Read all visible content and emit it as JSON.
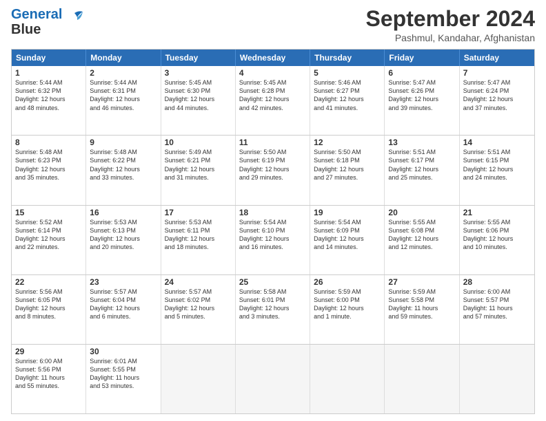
{
  "logo": {
    "line1": "General",
    "line2": "Blue"
  },
  "title": "September 2024",
  "subtitle": "Pashmul, Kandahar, Afghanistan",
  "header_days": [
    "Sunday",
    "Monday",
    "Tuesday",
    "Wednesday",
    "Thursday",
    "Friday",
    "Saturday"
  ],
  "weeks": [
    [
      {
        "day": "1",
        "info": "Sunrise: 5:44 AM\nSunset: 6:32 PM\nDaylight: 12 hours\nand 48 minutes."
      },
      {
        "day": "2",
        "info": "Sunrise: 5:44 AM\nSunset: 6:31 PM\nDaylight: 12 hours\nand 46 minutes."
      },
      {
        "day": "3",
        "info": "Sunrise: 5:45 AM\nSunset: 6:30 PM\nDaylight: 12 hours\nand 44 minutes."
      },
      {
        "day": "4",
        "info": "Sunrise: 5:45 AM\nSunset: 6:28 PM\nDaylight: 12 hours\nand 42 minutes."
      },
      {
        "day": "5",
        "info": "Sunrise: 5:46 AM\nSunset: 6:27 PM\nDaylight: 12 hours\nand 41 minutes."
      },
      {
        "day": "6",
        "info": "Sunrise: 5:47 AM\nSunset: 6:26 PM\nDaylight: 12 hours\nand 39 minutes."
      },
      {
        "day": "7",
        "info": "Sunrise: 5:47 AM\nSunset: 6:24 PM\nDaylight: 12 hours\nand 37 minutes."
      }
    ],
    [
      {
        "day": "8",
        "info": "Sunrise: 5:48 AM\nSunset: 6:23 PM\nDaylight: 12 hours\nand 35 minutes."
      },
      {
        "day": "9",
        "info": "Sunrise: 5:48 AM\nSunset: 6:22 PM\nDaylight: 12 hours\nand 33 minutes."
      },
      {
        "day": "10",
        "info": "Sunrise: 5:49 AM\nSunset: 6:21 PM\nDaylight: 12 hours\nand 31 minutes."
      },
      {
        "day": "11",
        "info": "Sunrise: 5:50 AM\nSunset: 6:19 PM\nDaylight: 12 hours\nand 29 minutes."
      },
      {
        "day": "12",
        "info": "Sunrise: 5:50 AM\nSunset: 6:18 PM\nDaylight: 12 hours\nand 27 minutes."
      },
      {
        "day": "13",
        "info": "Sunrise: 5:51 AM\nSunset: 6:17 PM\nDaylight: 12 hours\nand 25 minutes."
      },
      {
        "day": "14",
        "info": "Sunrise: 5:51 AM\nSunset: 6:15 PM\nDaylight: 12 hours\nand 24 minutes."
      }
    ],
    [
      {
        "day": "15",
        "info": "Sunrise: 5:52 AM\nSunset: 6:14 PM\nDaylight: 12 hours\nand 22 minutes."
      },
      {
        "day": "16",
        "info": "Sunrise: 5:53 AM\nSunset: 6:13 PM\nDaylight: 12 hours\nand 20 minutes."
      },
      {
        "day": "17",
        "info": "Sunrise: 5:53 AM\nSunset: 6:11 PM\nDaylight: 12 hours\nand 18 minutes."
      },
      {
        "day": "18",
        "info": "Sunrise: 5:54 AM\nSunset: 6:10 PM\nDaylight: 12 hours\nand 16 minutes."
      },
      {
        "day": "19",
        "info": "Sunrise: 5:54 AM\nSunset: 6:09 PM\nDaylight: 12 hours\nand 14 minutes."
      },
      {
        "day": "20",
        "info": "Sunrise: 5:55 AM\nSunset: 6:08 PM\nDaylight: 12 hours\nand 12 minutes."
      },
      {
        "day": "21",
        "info": "Sunrise: 5:55 AM\nSunset: 6:06 PM\nDaylight: 12 hours\nand 10 minutes."
      }
    ],
    [
      {
        "day": "22",
        "info": "Sunrise: 5:56 AM\nSunset: 6:05 PM\nDaylight: 12 hours\nand 8 minutes."
      },
      {
        "day": "23",
        "info": "Sunrise: 5:57 AM\nSunset: 6:04 PM\nDaylight: 12 hours\nand 6 minutes."
      },
      {
        "day": "24",
        "info": "Sunrise: 5:57 AM\nSunset: 6:02 PM\nDaylight: 12 hours\nand 5 minutes."
      },
      {
        "day": "25",
        "info": "Sunrise: 5:58 AM\nSunset: 6:01 PM\nDaylight: 12 hours\nand 3 minutes."
      },
      {
        "day": "26",
        "info": "Sunrise: 5:59 AM\nSunset: 6:00 PM\nDaylight: 12 hours\nand 1 minute."
      },
      {
        "day": "27",
        "info": "Sunrise: 5:59 AM\nSunset: 5:58 PM\nDaylight: 11 hours\nand 59 minutes."
      },
      {
        "day": "28",
        "info": "Sunrise: 6:00 AM\nSunset: 5:57 PM\nDaylight: 11 hours\nand 57 minutes."
      }
    ],
    [
      {
        "day": "29",
        "info": "Sunrise: 6:00 AM\nSunset: 5:56 PM\nDaylight: 11 hours\nand 55 minutes."
      },
      {
        "day": "30",
        "info": "Sunrise: 6:01 AM\nSunset: 5:55 PM\nDaylight: 11 hours\nand 53 minutes."
      },
      {
        "day": "",
        "info": ""
      },
      {
        "day": "",
        "info": ""
      },
      {
        "day": "",
        "info": ""
      },
      {
        "day": "",
        "info": ""
      },
      {
        "day": "",
        "info": ""
      }
    ]
  ]
}
